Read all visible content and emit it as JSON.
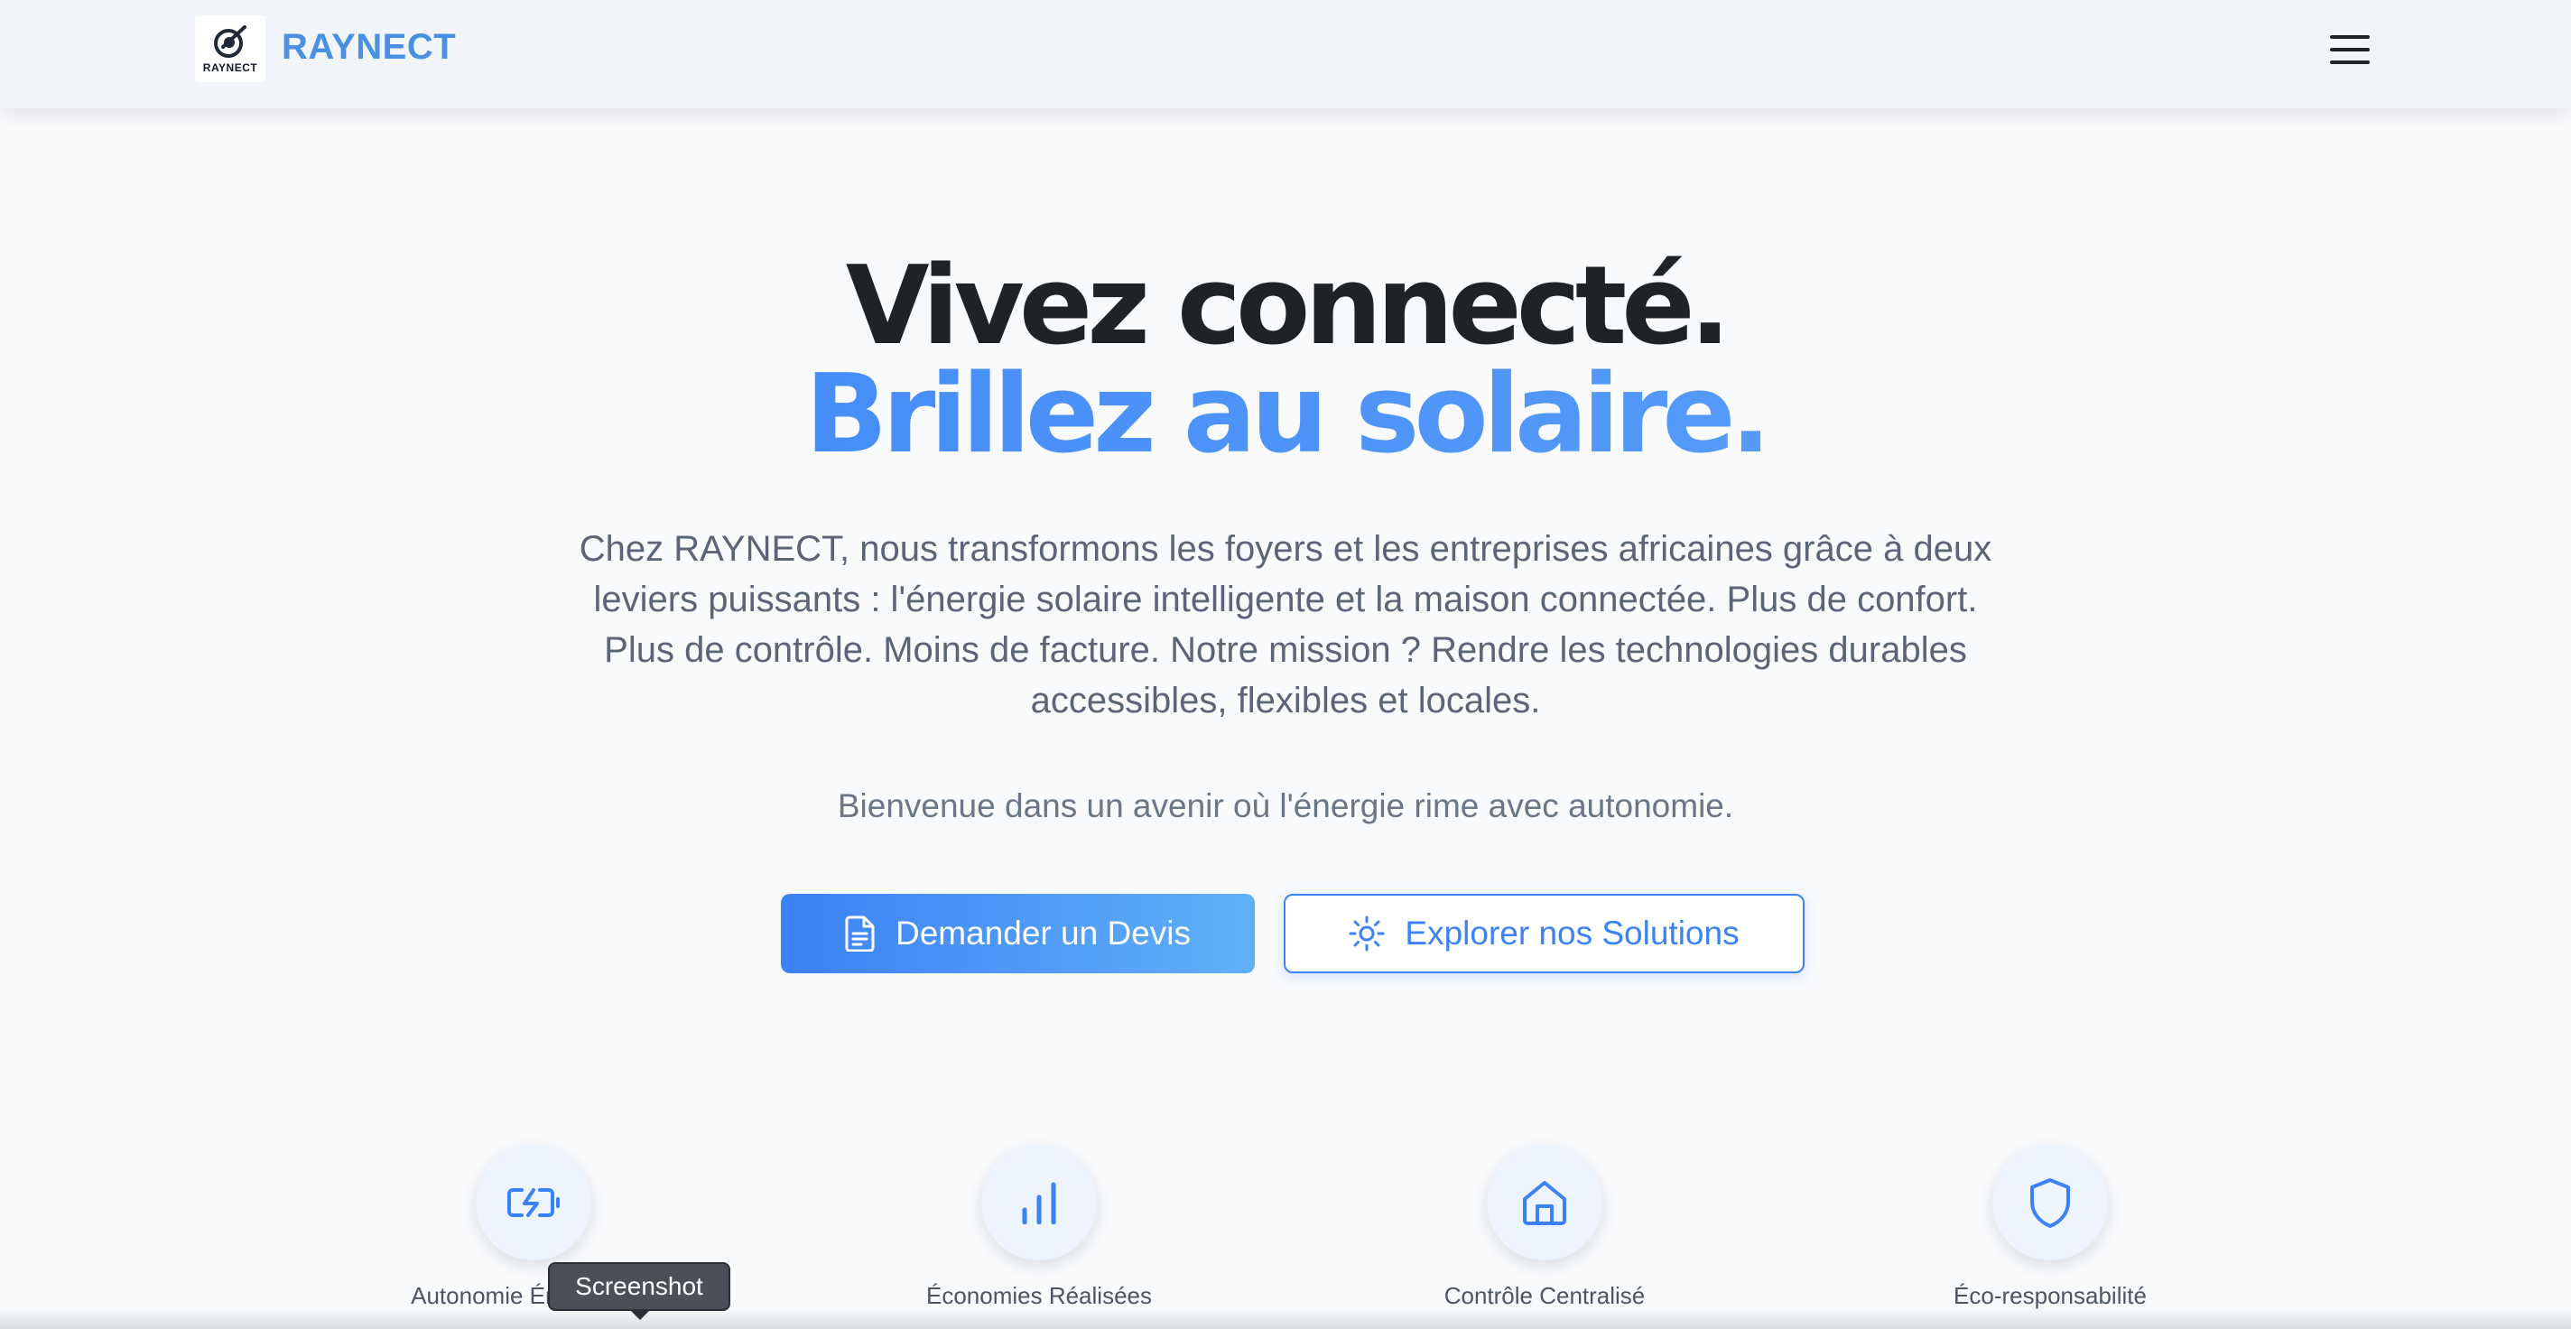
{
  "header": {
    "logo_text": "RAYNECT",
    "brand": "RAYNECT",
    "menu_icon": "hamburger-menu-icon"
  },
  "hero": {
    "title_line1": "Vivez connecté.",
    "title_line2": "Brillez au solaire.",
    "lead": "Chez RAYNECT, nous transformons les foyers et les entreprises africaines grâce à deux leviers puissants : l'énergie solaire intelligente et la maison connectée. Plus de confort. Plus de contrôle. Moins de facture. Notre mission ? Rendre les technologies durables accessibles, flexibles et locales.",
    "tagline": "Bienvenue dans un avenir où l'énergie rime avec autonomie.",
    "cta_primary": "Demander un Devis",
    "cta_secondary": "Explorer nos Solutions"
  },
  "features": [
    {
      "label": "Autonomie Énergétique",
      "icon": "battery-charging-icon"
    },
    {
      "label": "Économies Réalisées",
      "icon": "bar-chart-icon"
    },
    {
      "label": "Contrôle Centralisé",
      "icon": "home-icon"
    },
    {
      "label": "Éco-responsabilité",
      "icon": "shield-icon"
    }
  ],
  "tooltip": {
    "text": "Screenshot"
  },
  "colors": {
    "accent": "#3b82f6",
    "brand": "#4a90e2",
    "heading": "#1f2328",
    "body_text": "#5b6577",
    "background": "#f8fafc"
  }
}
